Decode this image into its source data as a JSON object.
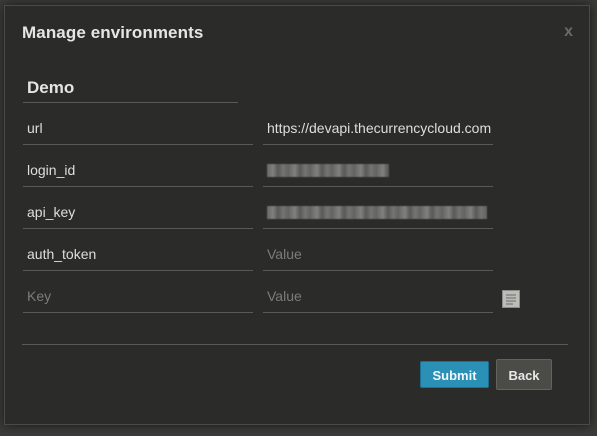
{
  "dialog": {
    "title": "Manage environments",
    "close_label": "x",
    "environment_name": "Demo"
  },
  "rows": [
    {
      "key": "url",
      "value": "https://devapi.thecurrencycloud.com",
      "value_state": "text"
    },
    {
      "key": "login_id",
      "value": "",
      "value_state": "redacted"
    },
    {
      "key": "api_key",
      "value": "",
      "value_state": "redacted"
    },
    {
      "key": "auth_token",
      "value": "Value",
      "value_state": "placeholder"
    }
  ],
  "new_row": {
    "key_placeholder": "Key",
    "value_placeholder": "Value",
    "icon": "note-icon"
  },
  "buttons": {
    "submit_label": "Submit",
    "back_label": "Back"
  },
  "colors": {
    "accent": "#2a90b5",
    "background": "#2b2b29"
  }
}
